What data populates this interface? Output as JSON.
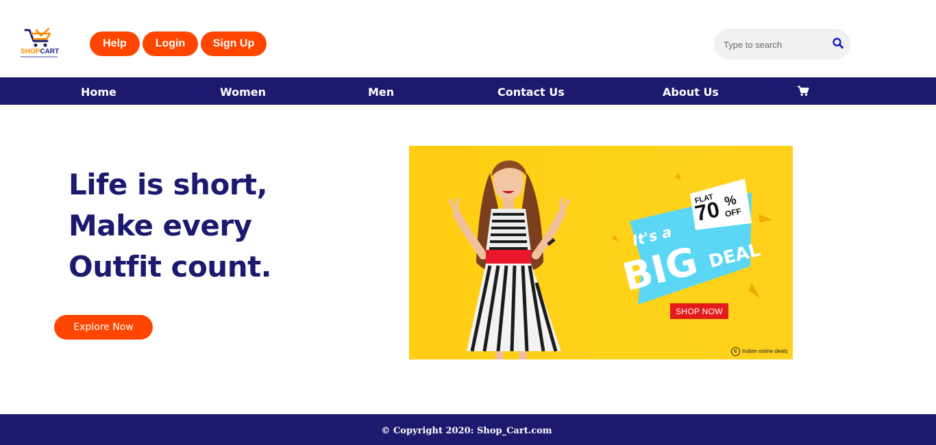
{
  "brand": {
    "logo_text_shop": "SHOP",
    "logo_text_cart": "CART",
    "accent_color": "#ff4500",
    "primary_color": "#1b1a6e"
  },
  "header": {
    "buttons": {
      "help": "Help",
      "login": "Login",
      "signup": "Sign Up"
    },
    "search": {
      "placeholder": "Type to search",
      "icon": "search-icon"
    }
  },
  "nav": {
    "items": [
      {
        "label": "Home"
      },
      {
        "label": "Women"
      },
      {
        "label": "Men"
      },
      {
        "label": "Contact Us"
      },
      {
        "label": "About Us"
      }
    ],
    "cart_icon": "shopping-cart-icon"
  },
  "hero": {
    "title_lines": [
      "Life is short,",
      "Make every",
      "Outfit count."
    ],
    "cta_label": "Explore Now"
  },
  "banner": {
    "flat_label": "FLAT",
    "discount_value": "70",
    "percent_sign": "%",
    "off_label": "OFF",
    "its_a": "It's a",
    "big": "BIG",
    "deal": "DEAL",
    "shop_now": "SHOP NOW",
    "credit": "Indian online dealz"
  },
  "footer": {
    "copyright": "© Copyright 2020:  Shop_Cart.com"
  }
}
